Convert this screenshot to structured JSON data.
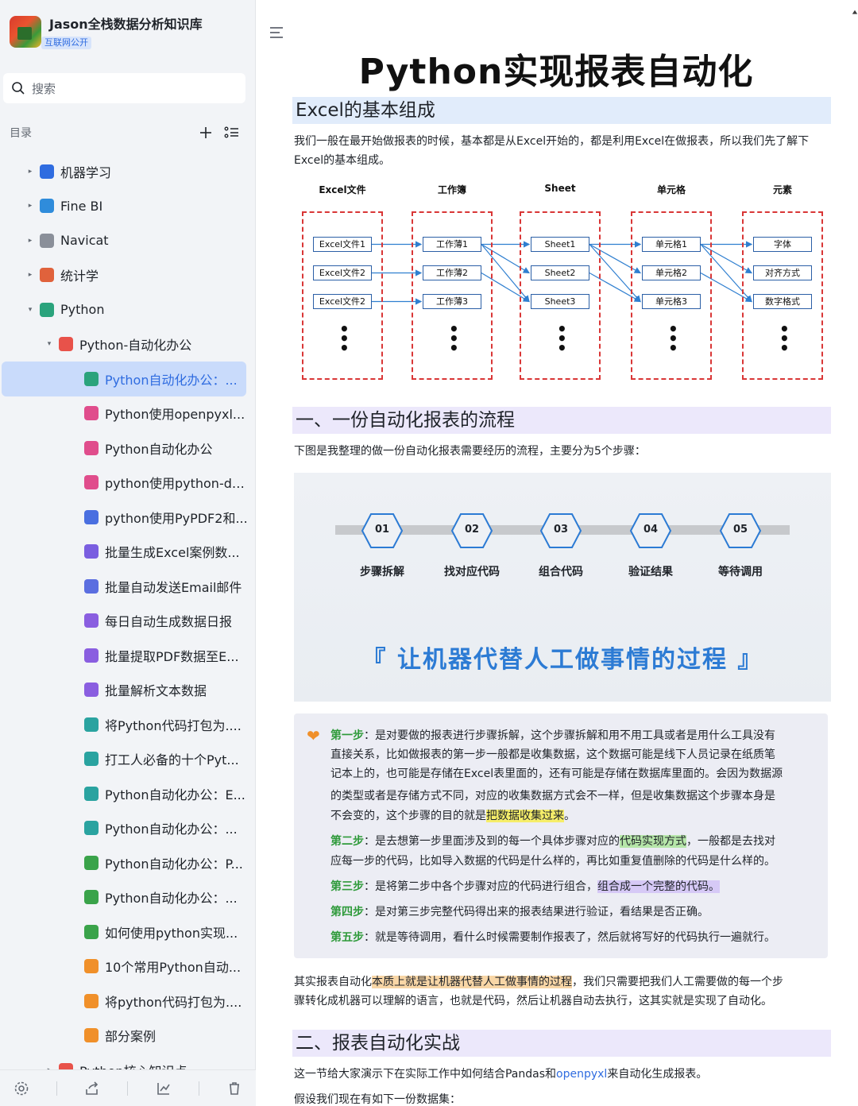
{
  "sidebar": {
    "kb_title": "Jason全栈数据分析知识库",
    "kb_badge": "互联网公开",
    "search_label": "搜索",
    "toc_label": "目录",
    "tree": [
      {
        "label": "机器学习",
        "level": 1,
        "arrow": "▸",
        "icon_color": "#2f6ce0",
        "icon": "ml-icon"
      },
      {
        "label": "Fine BI",
        "level": 1,
        "arrow": "▸",
        "icon_color": "#2f8cdb",
        "icon": "globe-icon"
      },
      {
        "label": "Navicat",
        "level": 1,
        "arrow": "▸",
        "icon_color": "#8a8f99",
        "icon": "gear-icon"
      },
      {
        "label": "统计学",
        "level": 1,
        "arrow": "▸",
        "icon_color": "#e0623c",
        "icon": "book-icon"
      },
      {
        "label": "Python",
        "level": 1,
        "arrow": "▾",
        "icon_color": "#2aa37c",
        "icon": "python-icon"
      },
      {
        "label": "Python-自动化办公",
        "level": 2,
        "arrow": "▾",
        "icon_color": "#e8524a",
        "icon": "folder-icon"
      },
      {
        "label": "Python自动化办公：...",
        "level": 3,
        "arrow": "",
        "icon_color": "#2aa37c",
        "icon": "doc-icon",
        "active": true
      },
      {
        "label": "Python使用openpyxl...",
        "level": 3,
        "arrow": "",
        "icon_color": "#e04d8c",
        "icon": "doc-icon"
      },
      {
        "label": "Python自动化办公",
        "level": 3,
        "arrow": "",
        "icon_color": "#e04d8c",
        "icon": "doc-icon"
      },
      {
        "label": "python使用python-do...",
        "level": 3,
        "arrow": "",
        "icon_color": "#e04d8c",
        "icon": "doc-icon"
      },
      {
        "label": "python使用PyPDF2和...",
        "level": 3,
        "arrow": "",
        "icon_color": "#4a6fe0",
        "icon": "doc-icon"
      },
      {
        "label": "批量生成Excel案例数...",
        "level": 3,
        "arrow": "",
        "icon_color": "#7a5ee0",
        "icon": "doc-icon"
      },
      {
        "label": "批量自动发送Email邮件",
        "level": 3,
        "arrow": "",
        "icon_color": "#5b6ee0",
        "icon": "grid-icon"
      },
      {
        "label": "每日自动生成数据日报",
        "level": 3,
        "arrow": "",
        "icon_color": "#8a5ee0",
        "icon": "doc-icon"
      },
      {
        "label": "批量提取PDF数据至E...",
        "level": 3,
        "arrow": "",
        "icon_color": "#8a5ee0",
        "icon": "doc-icon"
      },
      {
        "label": "批量解析文本数据",
        "level": 3,
        "arrow": "",
        "icon_color": "#8a5ee0",
        "icon": "chart-icon"
      },
      {
        "label": "将Python代码打包为....",
        "level": 3,
        "arrow": "",
        "icon_color": "#2aa3a0",
        "icon": "doc-icon"
      },
      {
        "label": "打工人必备的十个Pyt...",
        "level": 3,
        "arrow": "",
        "icon_color": "#2aa3a0",
        "icon": "doc-icon"
      },
      {
        "label": "Python自动化办公：E...",
        "level": 3,
        "arrow": "",
        "icon_color": "#2aa3a0",
        "icon": "doc-icon"
      },
      {
        "label": "Python自动化办公：...",
        "level": 3,
        "arrow": "",
        "icon_color": "#2aa3a0",
        "icon": "doc-icon"
      },
      {
        "label": "Python自动化办公：P...",
        "level": 3,
        "arrow": "",
        "icon_color": "#3aa34a",
        "icon": "doc-icon"
      },
      {
        "label": "Python自动化办公：...",
        "level": 3,
        "arrow": "",
        "icon_color": "#3aa34a",
        "icon": "doc-icon"
      },
      {
        "label": "如何使用python实现...",
        "level": 3,
        "arrow": "",
        "icon_color": "#3aa34a",
        "icon": "doc-icon"
      },
      {
        "label": "10个常用Python自动...",
        "level": 3,
        "arrow": "",
        "icon_color": "#f0902a",
        "icon": "doc-icon"
      },
      {
        "label": "将python代码打包为....",
        "level": 3,
        "arrow": "",
        "icon_color": "#f0902a",
        "icon": "doc-icon"
      },
      {
        "label": "部分案例",
        "level": 3,
        "arrow": "",
        "icon_color": "#f0902a",
        "icon": "doc-icon"
      },
      {
        "label": "Python核心知识点",
        "level": 2,
        "arrow": "▸",
        "icon_color": "#e8524a",
        "icon": "folder-icon"
      }
    ]
  },
  "doc": {
    "title": "Python实现报表自动化",
    "h_excel": "Excel的基本组成",
    "p_excel": "我们一般在最开始做报表的时候，基本都是从Excel开始的，都是利用Excel在做报表，所以我们先了解下Excel的基本组成。",
    "diagram": {
      "columns": [
        {
          "head": "Excel文件",
          "cells": [
            "Excel文件1",
            "Excel文件2",
            "Excel文件2"
          ]
        },
        {
          "head": "工作簿",
          "cells": [
            "工作薄1",
            "工作薄2",
            "工作薄3"
          ]
        },
        {
          "head": "Sheet",
          "cells": [
            "Sheet1",
            "Sheet2",
            "Sheet3"
          ]
        },
        {
          "head": "单元格",
          "cells": [
            "单元格1",
            "单元格2",
            "单元格3"
          ]
        },
        {
          "head": "元素",
          "cells": [
            "字体",
            "对齐方式",
            "数字格式"
          ]
        }
      ],
      "dots": "⋮"
    },
    "h_flow": "一、一份自动化报表的流程",
    "p_flow": "下图是我整理的做一份自动化报表需要经历的流程，主要分为5个步骤：",
    "steps": [
      {
        "num": "01",
        "label": "步骤拆解"
      },
      {
        "num": "02",
        "label": "找对应代码"
      },
      {
        "num": "03",
        "label": "组合代码"
      },
      {
        "num": "04",
        "label": "验证结果"
      },
      {
        "num": "05",
        "label": "等待调用"
      }
    ],
    "slogan": "『  让机器代替人工做事情的过程  』",
    "callout": {
      "s1_kw": "第一步",
      "s1_a": "：是对要做的报表进行步骤拆解，这个步骤拆解和用不用工具或者是用什么工具没有",
      "s1_b": "直接关系，比如做报表的第一步一般都是收集数据，这个数据可能是线下人员记录在纸质笔",
      "s1_c": "记本上的，也可能是存储在Excel表里面的，还有可能是存储在数据库里面的。会因为数据源",
      "s1_d": "的类型或者是存储方式不同，对应的收集数据方式会不一样，但是收集数据这个步骤本身是",
      "s1_e1": "不会变的，这个步骤的目的就是",
      "s1_e_hl": "把数据收集过来",
      "s1_e2": "。",
      "s2_kw": "第二步",
      "s2_a1": "：是去想第一步里面涉及到的每一个具体步骤对应的",
      "s2_a_hl": "代码实现方式",
      "s2_a2": "，一般都是去找对",
      "s2_b": "应每一步的代码，比如导入数据的代码是什么样的，再比如重复值删除的代码是什么样的。",
      "s3_kw": "第三步",
      "s3_a": "：是将第二步中各个步骤对应的代码进行组合，",
      "s3_hl": "组合成一个完整的代码。",
      "s4_kw": "第四步",
      "s4_a": "：是对第三步完整代码得出来的报表结果进行验证，看结果是否正确。",
      "s5_kw": "第五步",
      "s5_a": "：就是等待调用，看什么时候需要制作报表了，然后就将写好的代码执行一遍就行。"
    },
    "p_summary_a1": "其实报表自动化",
    "p_summary_hl": "本质上就是让机器代替人工做事情的过程",
    "p_summary_a2": "，我们只需要把我们人工需要做的每一个步",
    "p_summary_b": "骤转化成机器可以理解的语言，也就是代码，然后让机器自动去执行，这其实就是实现了自动化。",
    "h_practice": "二、报表自动化实战",
    "p_practice_a": "这一节给大家演示下在实际工作中如何结合Pandas和",
    "p_practice_link": "openpyxl",
    "p_practice_b": "来自动化生成报表。",
    "p_dataset": "假设我们现在有如下一份数据集："
  }
}
